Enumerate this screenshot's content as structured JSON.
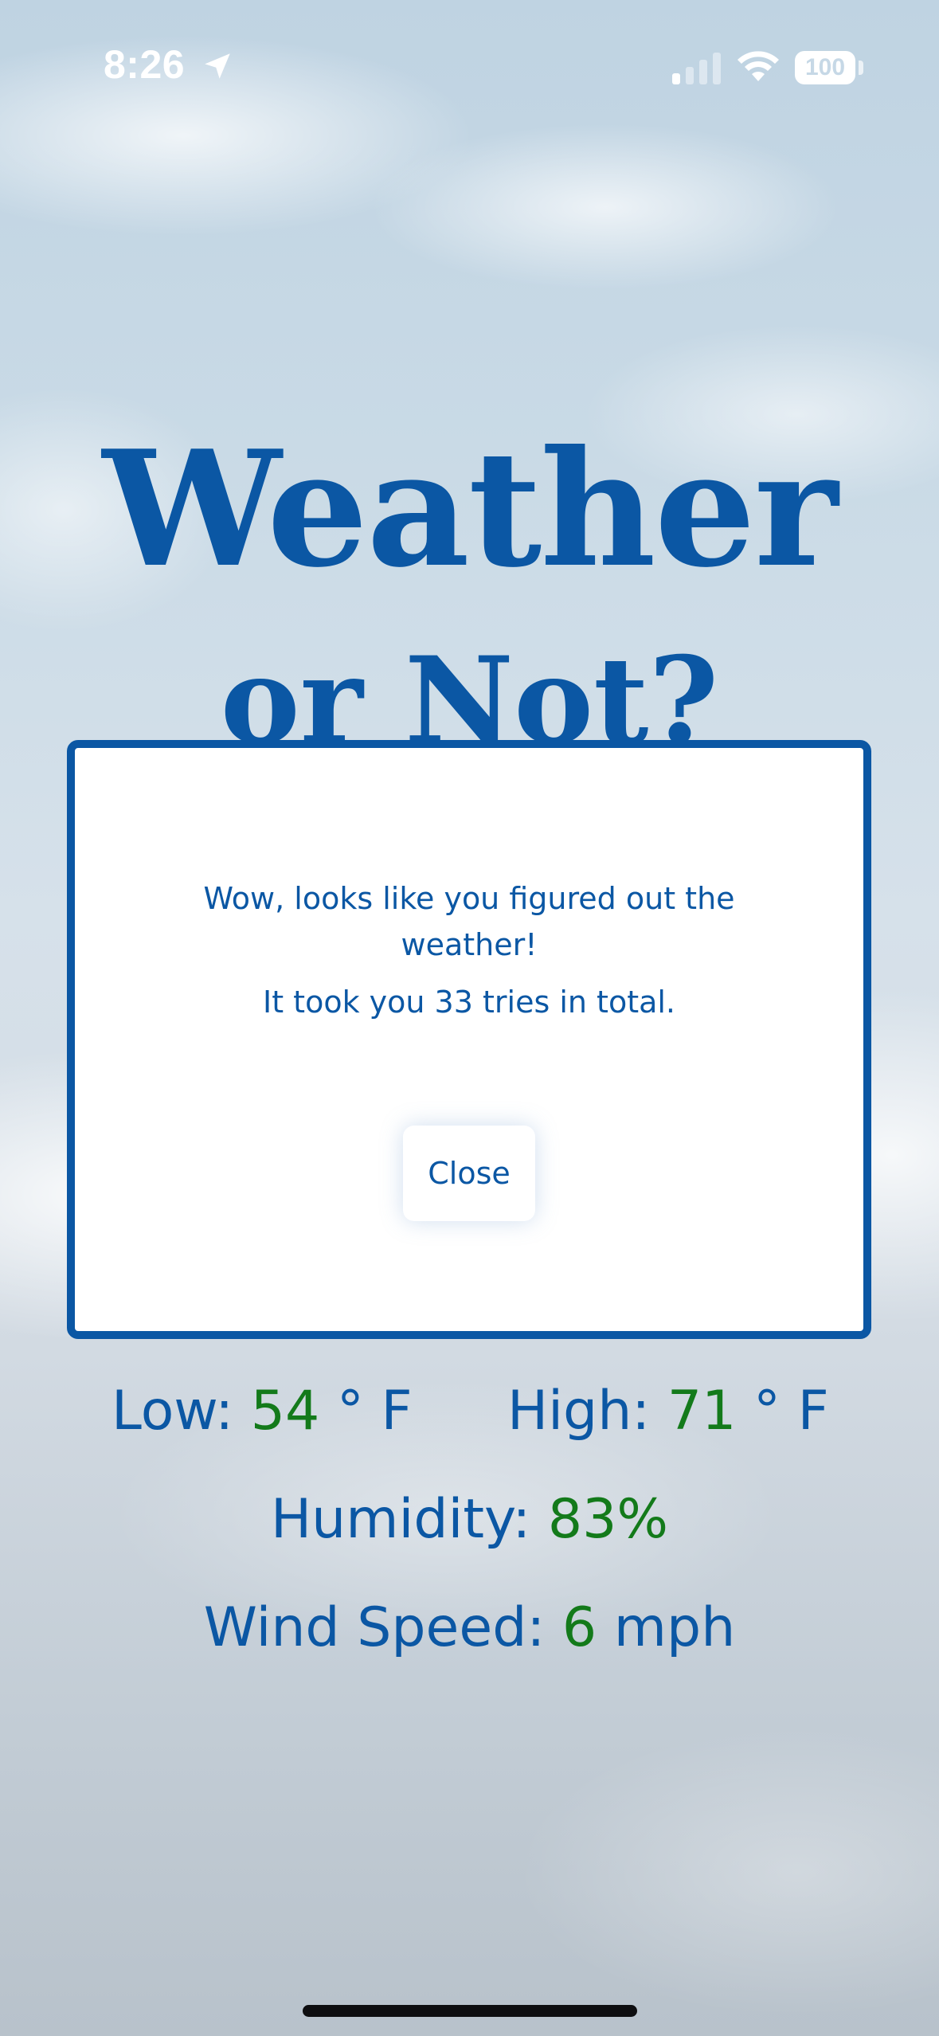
{
  "status_bar": {
    "time": "8:26",
    "battery": "100",
    "icons": [
      "location-arrow-icon",
      "cellular-signal-icon",
      "wifi-icon",
      "battery-icon"
    ]
  },
  "title": {
    "main": "Weather",
    "sub": "or Not?"
  },
  "modal": {
    "message_line1": "Wow, looks like you figured out the",
    "message_line2": "weather!",
    "tries_text": "It took you 33 tries in total.",
    "close_label": "Close"
  },
  "stats": {
    "low_label": "Low: ",
    "low_value": "54",
    "low_unit": " ° F",
    "high_label": "High: ",
    "high_value": "71",
    "high_unit": " ° F",
    "humidity_label": "Humidity: ",
    "humidity_value": "83%",
    "wind_label": "Wind Speed: ",
    "wind_value": "6",
    "wind_unit": " mph"
  },
  "colors": {
    "primary_blue": "#0b57a4",
    "value_green": "#137a1a",
    "modal_background": "#ffffff"
  }
}
